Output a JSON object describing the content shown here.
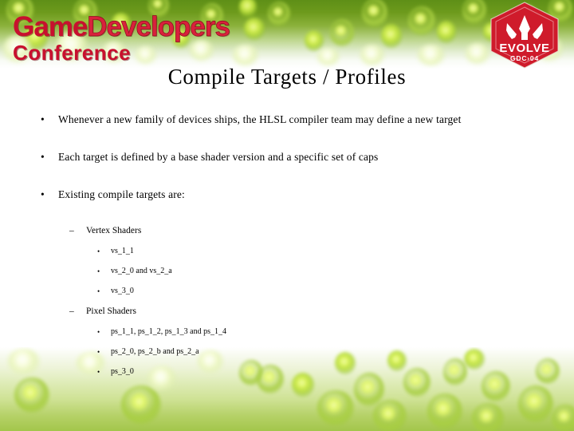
{
  "branding": {
    "wordmark_game": "Game",
    "wordmark_developers": "Developers",
    "wordmark_conference": "Conference",
    "badge_name": "EVOLVE",
    "badge_sub": "GDC›04",
    "brand_red": "#c8102e",
    "brand_green": "#6d9a1c"
  },
  "title": "Compile Targets / Profiles",
  "bullets": [
    {
      "marker": "•",
      "text": "Whenever a new family of devices ships, the HLSL compiler team may define a new target"
    },
    {
      "marker": "•",
      "text": "Each target is defined by a base shader version and a specific set of caps"
    },
    {
      "marker": "•",
      "text": "Existing compile targets are:"
    }
  ],
  "groups": [
    {
      "marker": "–",
      "label": "Vertex Shaders",
      "items": [
        {
          "marker": "•",
          "text": "vs_1_1"
        },
        {
          "marker": "•",
          "text": "vs_2_0 and vs_2_a"
        },
        {
          "marker": "•",
          "text": "vs_3_0"
        }
      ]
    },
    {
      "marker": "–",
      "label": "Pixel Shaders",
      "items": [
        {
          "marker": "•",
          "text": "ps_1_1, ps_1_2, ps_1_3 and ps_1_4"
        },
        {
          "marker": "•",
          "text": "ps_2_0, ps_2_b and ps_2_a"
        },
        {
          "marker": "•",
          "text": "ps_3_0"
        }
      ]
    }
  ]
}
